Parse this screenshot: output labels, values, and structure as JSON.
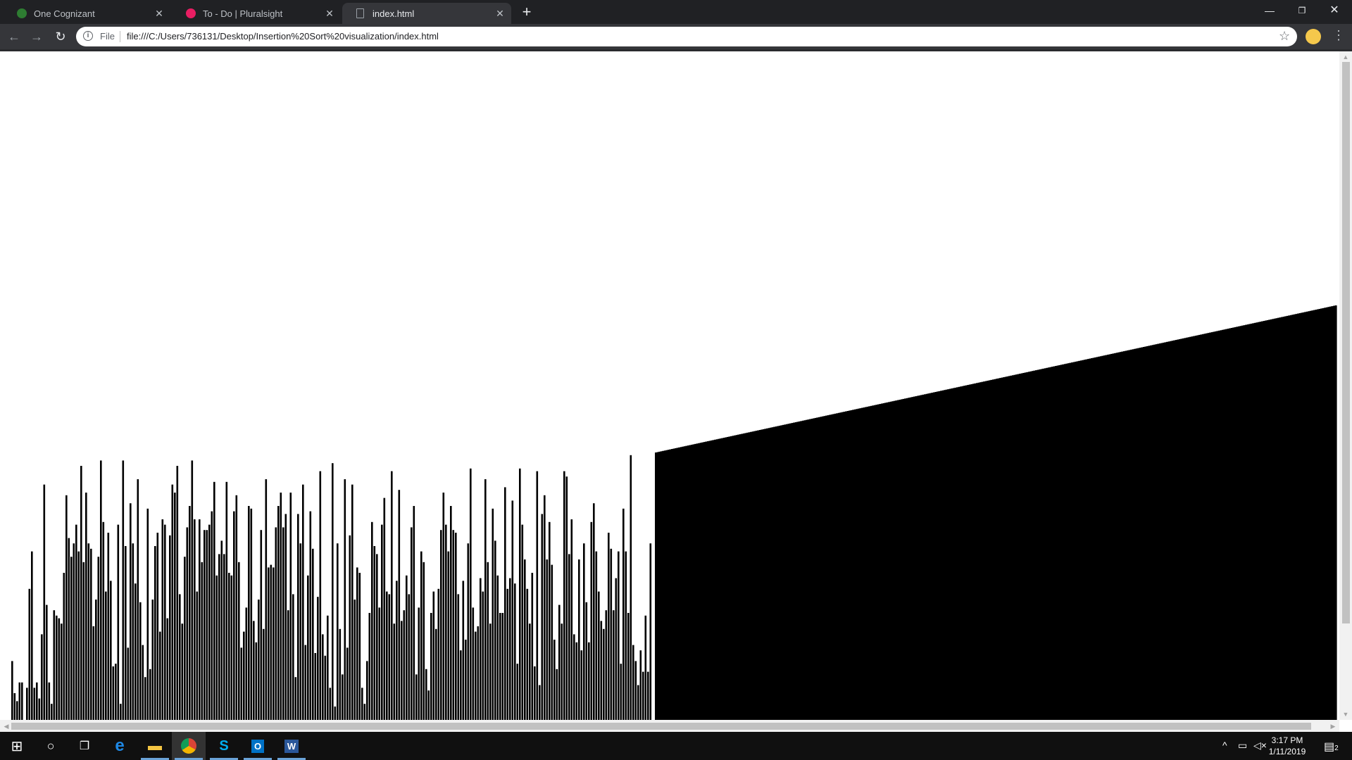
{
  "browser": {
    "tabs": [
      {
        "title": "One Cognizant",
        "favicon_color": "#2e7d32",
        "active": false
      },
      {
        "title": "To - Do | Pluralsight",
        "favicon_color": "#e91e63",
        "active": false
      },
      {
        "title": "index.html",
        "favicon_color": "#9aa0a6",
        "active": true
      }
    ],
    "address": {
      "scheme_label": "File",
      "url": "file:///C:/Users/736131/Desktop/Insertion%20Sort%20visualization/index.html"
    }
  },
  "taskbar": {
    "time": "3:17 PM",
    "date": "1/11/2019",
    "notifications": "2"
  },
  "chart_data": {
    "type": "bar",
    "description_note": "",
    "bar_color": "#000000",
    "unsorted_values": [
      0.22,
      0.1,
      0.07,
      0.14,
      0.14,
      0.0,
      0.12,
      0.49,
      0.63,
      0.12,
      0.14,
      0.08,
      0.32,
      0.88,
      0.43,
      0.14,
      0.06,
      0.41,
      0.39,
      0.38,
      0.36,
      0.55,
      0.84,
      0.68,
      0.61,
      0.66,
      0.73,
      0.63,
      0.95,
      0.59,
      0.85,
      0.66,
      0.64,
      0.35,
      0.45,
      0.61,
      0.97,
      0.74,
      0.48,
      0.7,
      0.52,
      0.2,
      0.21,
      0.73,
      0.06,
      0.97,
      0.65,
      0.27,
      0.81,
      0.66,
      0.51,
      0.9,
      0.44,
      0.28,
      0.16,
      0.79,
      0.19,
      0.45,
      0.65,
      0.7,
      0.33,
      0.75,
      0.73,
      0.38,
      0.69,
      0.88,
      0.85,
      0.95,
      0.47,
      0.36,
      0.61,
      0.72,
      0.8,
      0.97,
      0.75,
      0.48,
      0.75,
      0.59,
      0.71,
      0.71,
      0.73,
      0.78,
      0.89,
      0.54,
      0.62,
      0.67,
      0.62,
      0.89,
      0.55,
      0.54,
      0.78,
      0.84,
      0.59,
      0.27,
      0.33,
      0.42,
      0.8,
      0.79,
      0.37,
      0.29,
      0.45,
      0.71,
      0.34,
      0.9,
      0.57,
      0.58,
      0.57,
      0.72,
      0.8,
      0.85,
      0.72,
      0.77,
      0.41,
      0.85,
      0.47,
      0.16,
      0.77,
      0.66,
      0.88,
      0.28,
      0.54,
      0.78,
      0.64,
      0.25,
      0.46,
      0.93,
      0.32,
      0.24,
      0.39,
      0.12,
      0.96,
      0.05,
      0.66,
      0.34,
      0.17,
      0.9,
      0.27,
      0.69,
      0.88,
      0.45,
      0.57,
      0.55,
      0.12,
      0.06,
      0.22,
      0.4,
      0.74,
      0.65,
      0.62,
      0.42,
      0.73,
      0.83,
      0.48,
      0.47,
      0.93,
      0.36,
      0.52,
      0.86,
      0.37,
      0.41,
      0.54,
      0.47,
      0.72,
      0.8,
      0.17,
      0.42,
      0.63,
      0.59,
      0.19,
      0.11,
      0.4,
      0.48,
      0.34,
      0.49,
      0.71,
      0.85,
      0.73,
      0.63,
      0.8,
      0.71,
      0.7,
      0.47,
      0.26,
      0.52,
      0.3,
      0.66,
      0.94,
      0.42,
      0.33,
      0.35,
      0.53,
      0.48,
      0.9,
      0.59,
      0.36,
      0.79,
      0.67,
      0.54,
      0.4,
      0.4,
      0.87,
      0.49,
      0.53,
      0.82,
      0.51,
      0.21,
      0.94,
      0.73,
      0.6,
      0.49,
      0.36,
      0.55,
      0.2,
      0.93,
      0.13,
      0.77,
      0.84,
      0.6,
      0.74,
      0.58,
      0.3,
      0.19,
      0.43,
      0.36,
      0.93,
      0.91,
      0.62,
      0.75,
      0.32,
      0.29,
      0.6,
      0.26,
      0.66,
      0.44,
      0.29,
      0.74,
      0.81,
      0.63,
      0.48,
      0.37,
      0.34,
      0.41,
      0.7,
      0.64,
      0.41,
      0.53,
      0.63,
      0.21,
      0.79,
      0.63,
      0.4,
      0.99,
      0.28,
      0.22,
      0.13,
      0.26,
      0.18,
      0.39,
      0.18,
      0.66
    ],
    "sorted_ramp": {
      "start": 1.0,
      "end": 1.55,
      "bars": 380
    }
  }
}
